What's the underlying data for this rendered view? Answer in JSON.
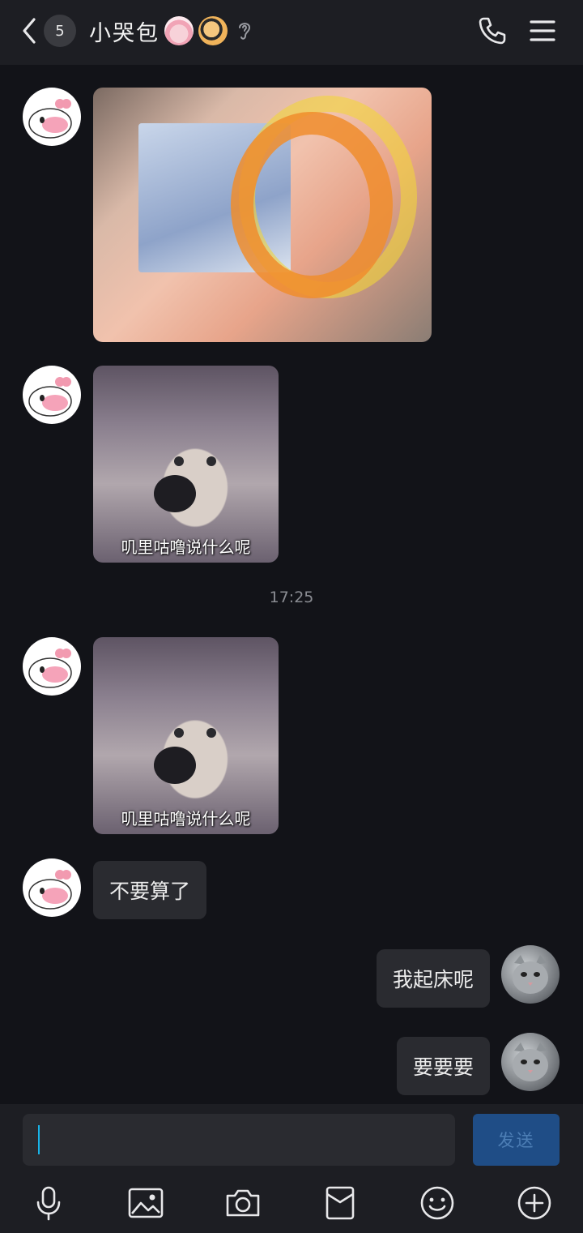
{
  "header": {
    "unread_count": "5",
    "title": "小哭包"
  },
  "messages": {
    "meme_caption_1": "叽里咕噜说什么呢",
    "meme_caption_2": "叽里咕噜说什么呢",
    "timestamp": "17:25",
    "text_1": "不要算了",
    "text_2": "我起床呢",
    "text_3": "要要要"
  },
  "input": {
    "value": "",
    "send_label": "发送"
  },
  "toolbar": {
    "icons": [
      "microphone-icon",
      "image-icon",
      "camera-icon",
      "red-packet-icon",
      "emoji-icon",
      "plus-icon"
    ]
  },
  "colors": {
    "background": "#121318",
    "header": "#1d1e23",
    "bubble": "#2a2b30",
    "send_button": "#1f4d86",
    "cursor": "#18b4e8"
  }
}
